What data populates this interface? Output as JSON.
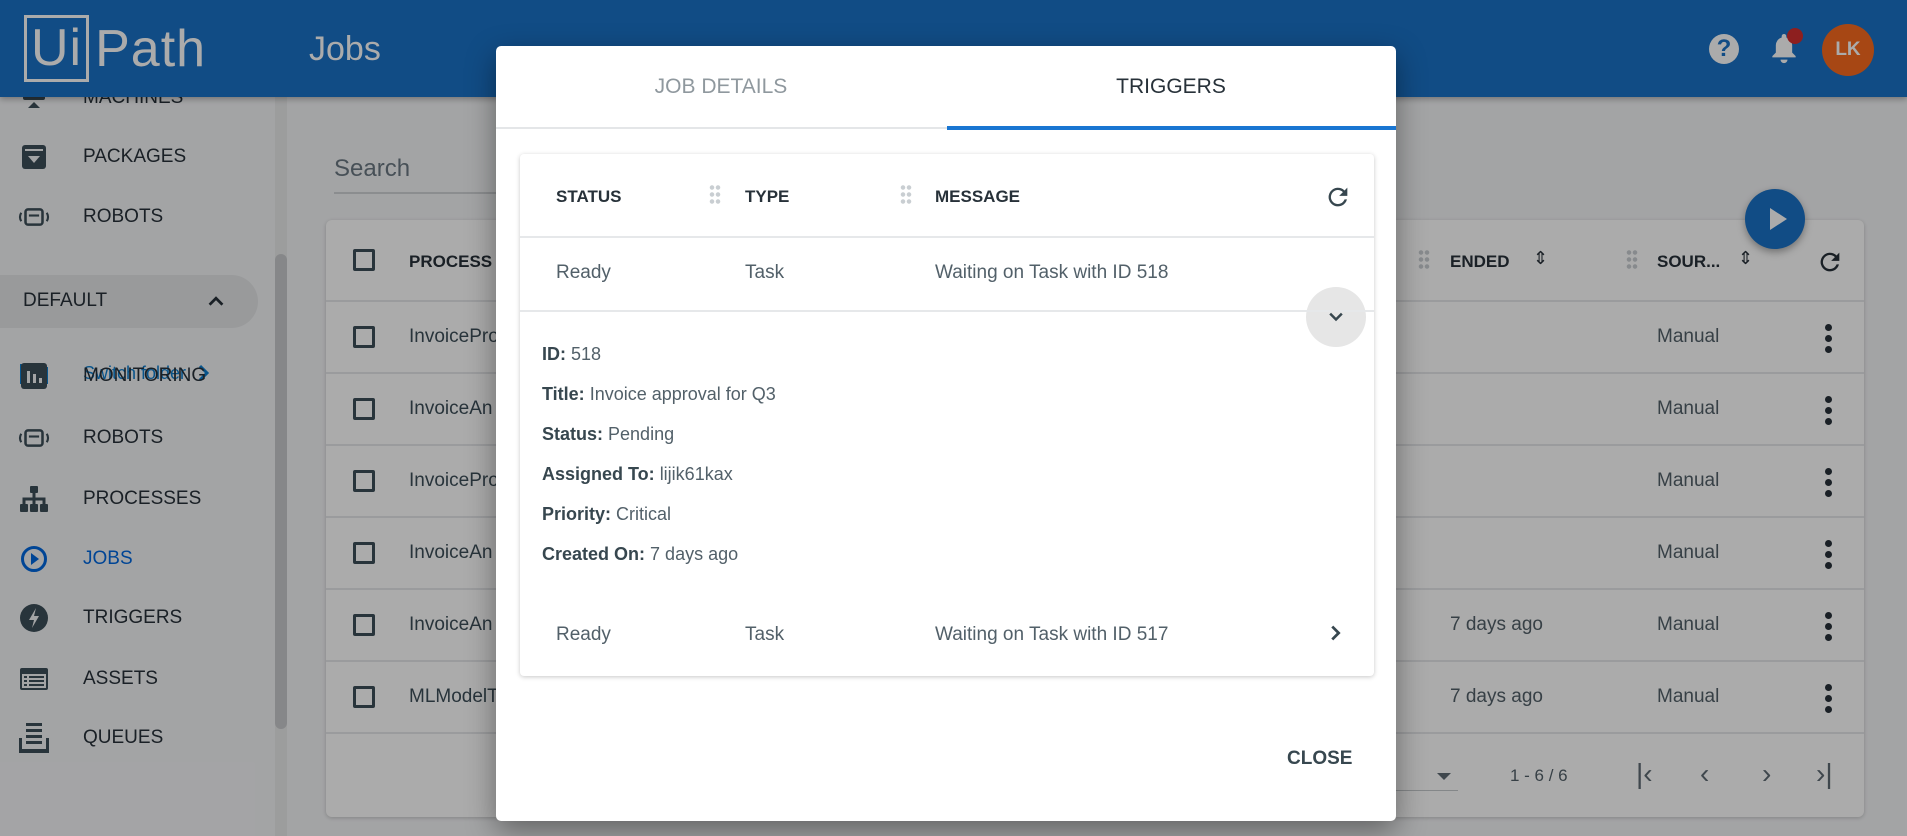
{
  "header": {
    "logo": "UiPath",
    "logo_ui": "Ui",
    "logo_path": "Path",
    "title": "Jobs",
    "help": "?",
    "avatar": "LK"
  },
  "sidebar": {
    "items": [
      {
        "label": "MACHINES",
        "icon": "machines-icon"
      },
      {
        "label": "PACKAGES",
        "icon": "packages-icon"
      },
      {
        "label": "ROBOTS",
        "icon": "robot-icon"
      },
      {
        "label": "MONITORING",
        "icon": "monitoring-icon"
      },
      {
        "label": "ROBOTS",
        "icon": "robot-icon"
      },
      {
        "label": "PROCESSES",
        "icon": "processes-icon"
      },
      {
        "label": "JOBS",
        "icon": "jobs-icon",
        "active": true
      },
      {
        "label": "TRIGGERS",
        "icon": "triggers-icon"
      },
      {
        "label": "ASSETS",
        "icon": "assets-icon"
      },
      {
        "label": "QUEUES",
        "icon": "queues-icon"
      }
    ],
    "folder": "DEFAULT",
    "switch_folder": "Switch folder"
  },
  "main": {
    "search_placeholder": "Search",
    "columns": {
      "process": "PROCESS",
      "ended": "ENDED",
      "source": "SOUR..."
    },
    "rows": [
      {
        "process": "InvoicePro",
        "ended": "",
        "source": "Manual"
      },
      {
        "process": "InvoiceAn",
        "ended": "",
        "source": "Manual"
      },
      {
        "process": "InvoicePro",
        "ended": "",
        "source": "Manual"
      },
      {
        "process": "InvoiceAn",
        "ended": "",
        "source": "Manual"
      },
      {
        "process": "InvoiceAn",
        "ended": "7 days ago",
        "source": "Manual"
      },
      {
        "process": "MLModelT",
        "ended": "7 days ago",
        "source": "Manual"
      }
    ],
    "pagination": "1 - 6 / 6"
  },
  "modal": {
    "tabs": [
      "JOB DETAILS",
      "TRIGGERS"
    ],
    "active_tab": "TRIGGERS",
    "columns": {
      "status": "STATUS",
      "type": "TYPE",
      "message": "MESSAGE"
    },
    "rows": [
      {
        "status": "Ready",
        "type": "Task",
        "message": "Waiting on Task with ID 518",
        "expanded": true
      },
      {
        "status": "Ready",
        "type": "Task",
        "message": "Waiting on Task with ID 517",
        "expanded": false
      }
    ],
    "details": [
      {
        "label": "ID:",
        "value": "518"
      },
      {
        "label": "Title:",
        "value": "Invoice approval for Q3"
      },
      {
        "label": "Status:",
        "value": "Pending"
      },
      {
        "label": "Assigned To:",
        "value": "lijik61kax"
      },
      {
        "label": "Priority:",
        "value": "Critical"
      },
      {
        "label": "Created On:",
        "value": " 7 days ago"
      }
    ],
    "close": "CLOSE"
  },
  "colors": {
    "brand": "#1a72c6",
    "accent": "#1976d2",
    "avatar": "#fa6b1e",
    "badge": "#d32f2f"
  }
}
